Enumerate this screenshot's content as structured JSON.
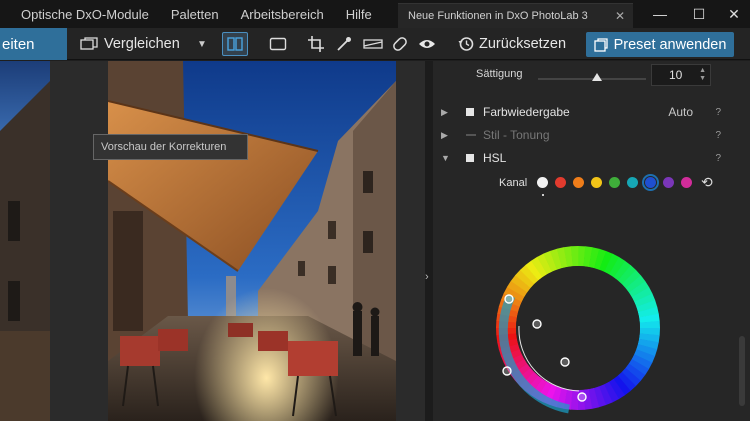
{
  "menu": {
    "items": [
      "Optische DxO-Module",
      "Paletten",
      "Arbeitsbereich",
      "Hilfe"
    ],
    "tab_title": "Neue Funktionen in DxO PhotoLab 3",
    "tab_close": "✕"
  },
  "window_controls": [
    "—",
    "☐",
    "✕"
  ],
  "toolbar": {
    "left_label": "eiten",
    "compare_label": "Vergleichen",
    "dropdown_glyph": "▼",
    "reset_label": "Zurücksetzen",
    "preset_label": "Preset anwenden"
  },
  "viewer": {
    "tooltip": "Vorschau der Korrekturen",
    "collapse_glyph": "›"
  },
  "panel": {
    "saturation": {
      "label": "Sättigung",
      "value": "10",
      "spin_up": "▲",
      "spin_down": "▼",
      "slider_level": 0.55
    },
    "sections": [
      {
        "title": "Farbwiedergabe",
        "aux": "Auto",
        "help": "?",
        "arrow": "▶",
        "enabled": true
      },
      {
        "title": "Stil - Tonung",
        "aux": "",
        "help": "?",
        "arrow": "▶",
        "enabled": false
      },
      {
        "title": "HSL",
        "aux": "",
        "help": "?",
        "arrow": "▼",
        "enabled": true
      }
    ],
    "hsl": {
      "channel_label": "Kanal",
      "channels": [
        {
          "name": "all",
          "color": "#f2f2f2"
        },
        {
          "name": "red",
          "color": "#e23b2e"
        },
        {
          "name": "orange",
          "color": "#ef7d1a"
        },
        {
          "name": "yellow",
          "color": "#f2c418"
        },
        {
          "name": "green",
          "color": "#3fae3a"
        },
        {
          "name": "cyan",
          "color": "#16a7b5"
        },
        {
          "name": "blue",
          "color": "#1f4fd1"
        },
        {
          "name": "purple",
          "color": "#7a36b8"
        },
        {
          "name": "magenta",
          "color": "#d12c9a"
        }
      ],
      "selected_channel": "blue",
      "reset_glyph": "⟲"
    }
  },
  "colors": {
    "accent": "#2f6f9a",
    "panel_bg": "#262626",
    "menubar_bg": "#161616"
  }
}
